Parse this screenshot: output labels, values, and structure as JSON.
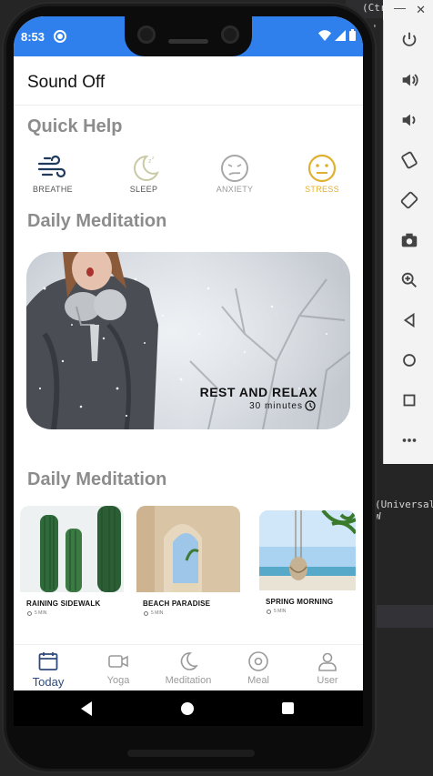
{
  "status_bar": {
    "time": "8:53"
  },
  "app_bar": {
    "title": "Sound Off"
  },
  "quick_help": {
    "title": "Quick Help",
    "items": [
      {
        "label": "BREATHE",
        "icon": "wind-icon",
        "color": "#1f3a5a"
      },
      {
        "label": "SLEEP",
        "icon": "moon-icon",
        "color": "#c9c9a6"
      },
      {
        "label": "ANXIETY",
        "icon": "anxious-face-icon",
        "color": "#a7a7a7"
      },
      {
        "label": "STRESS",
        "icon": "neutral-face-icon",
        "color": "#e0b030"
      }
    ]
  },
  "daily_meditation": {
    "title": "Daily Meditation",
    "hero": {
      "title": "REST AND RELAX",
      "duration": "30 minutes"
    }
  },
  "daily_meditation_list": {
    "title": "Daily Meditation",
    "cards": [
      {
        "title": "RAINING SIDEWALK",
        "meta": "5 MIN"
      },
      {
        "title": "BEACH PARADISE",
        "meta": "5 MIN"
      },
      {
        "title": "SPRING MORNING",
        "meta": "5 MIN"
      }
    ]
  },
  "bottom_nav": {
    "items": [
      {
        "label": "Today",
        "icon": "calendar-icon",
        "active": true
      },
      {
        "label": "Yoga",
        "icon": "video-icon",
        "active": false
      },
      {
        "label": "Meditation",
        "icon": "moon-icon",
        "active": false
      },
      {
        "label": "Meal",
        "icon": "target-icon",
        "active": false
      },
      {
        "label": "User",
        "icon": "user-icon",
        "active": false
      }
    ]
  },
  "ide_fragments": {
    "top": "(Ctrl",
    "s_text": "s'",
    "universal": "(Universal W"
  },
  "colors": {
    "accent": "#2f80ed",
    "nav_active": "#2f4b7c",
    "section_title": "#8c8c8c"
  }
}
